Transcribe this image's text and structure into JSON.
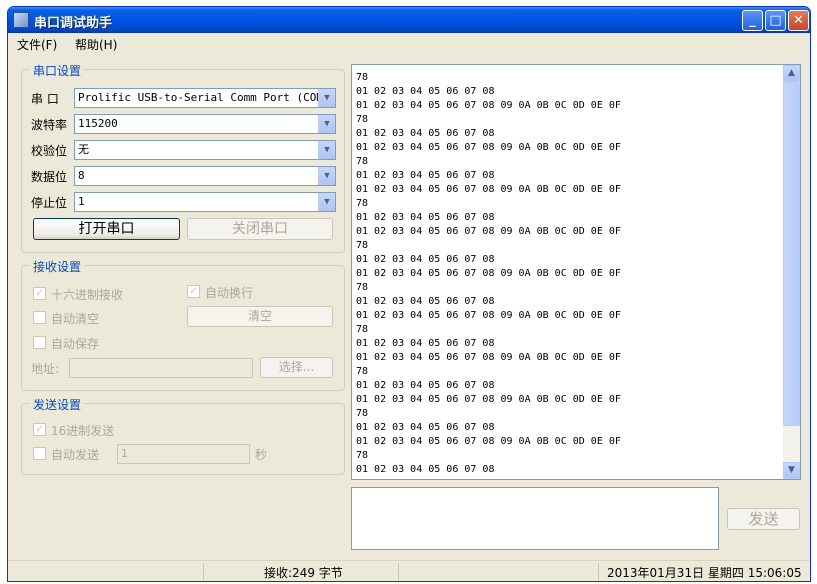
{
  "window": {
    "title": "串口调试助手"
  },
  "titlebar_buttons": {
    "minimize": "_",
    "maximize": "□",
    "close": "✕"
  },
  "menu": [
    "文件(F)",
    "帮助(H)"
  ],
  "serial": {
    "group_title": "串口设置",
    "port_label": "串 口",
    "port_value": "Prolific USB-to-Serial Comm Port (COM5)",
    "baud_label": "波特率",
    "baud_value": "115200",
    "parity_label": "校验位",
    "parity_value": "无",
    "databits_label": "数据位",
    "databits_value": "8",
    "stopbits_label": "停止位",
    "stopbits_value": "1",
    "open_button": "打开串口",
    "close_button": "关闭串口"
  },
  "receive": {
    "group_title": "接收设置",
    "hex_receive": "十六进制接收",
    "auto_wrap": "自动换行",
    "auto_clear": "自动清空",
    "clear_button": "清空",
    "auto_save": "自动保存",
    "address_label": "地址:",
    "select_button": "选择..."
  },
  "send": {
    "group_title": "发送设置",
    "hex_send": "16进制发送",
    "auto_send": "自动发送",
    "interval_value": "1",
    "interval_unit": "秒",
    "send_button": "发送"
  },
  "received_text": "78\n01 02 03 04 05 06 07 08\n01 02 03 04 05 06 07 08 09 0A 0B 0C 0D 0E 0F\n78\n01 02 03 04 05 06 07 08\n01 02 03 04 05 06 07 08 09 0A 0B 0C 0D 0E 0F\n78\n01 02 03 04 05 06 07 08\n01 02 03 04 05 06 07 08 09 0A 0B 0C 0D 0E 0F\n78\n01 02 03 04 05 06 07 08\n01 02 03 04 05 06 07 08 09 0A 0B 0C 0D 0E 0F\n78\n01 02 03 04 05 06 07 08\n01 02 03 04 05 06 07 08 09 0A 0B 0C 0D 0E 0F\n78\n01 02 03 04 05 06 07 08\n01 02 03 04 05 06 07 08 09 0A 0B 0C 0D 0E 0F\n78\n01 02 03 04 05 06 07 08\n01 02 03 04 05 06 07 08 09 0A 0B 0C 0D 0E 0F\n78\n01 02 03 04 05 06 07 08\n01 02 03 04 05 06 07 08 09 0A 0B 0C 0D 0E 0F\n78\n01 02 03 04 05 06 07 08\n01 02 03 04 05 06 07 08 09 0A 0B 0C 0D 0E 0F\n78\n01 02 03 04 05 06 07 08\n01 02 03 04 05 06 07 08 09 0A 0B 0C 0D 0E 0F",
  "status": {
    "received": "接收:249 字节",
    "datetime": "2013年01月31日 星期四 15:06:05"
  },
  "icons": {
    "combo_arrow": "chevron-down-icon",
    "scroll_up": "scroll-up-icon",
    "scroll_down": "scroll-down-icon",
    "checkmark": "check-icon"
  },
  "colors": {
    "titlebar": "#0055e5",
    "group_title": "#0046d5",
    "window_bg": "#ece9d8"
  }
}
